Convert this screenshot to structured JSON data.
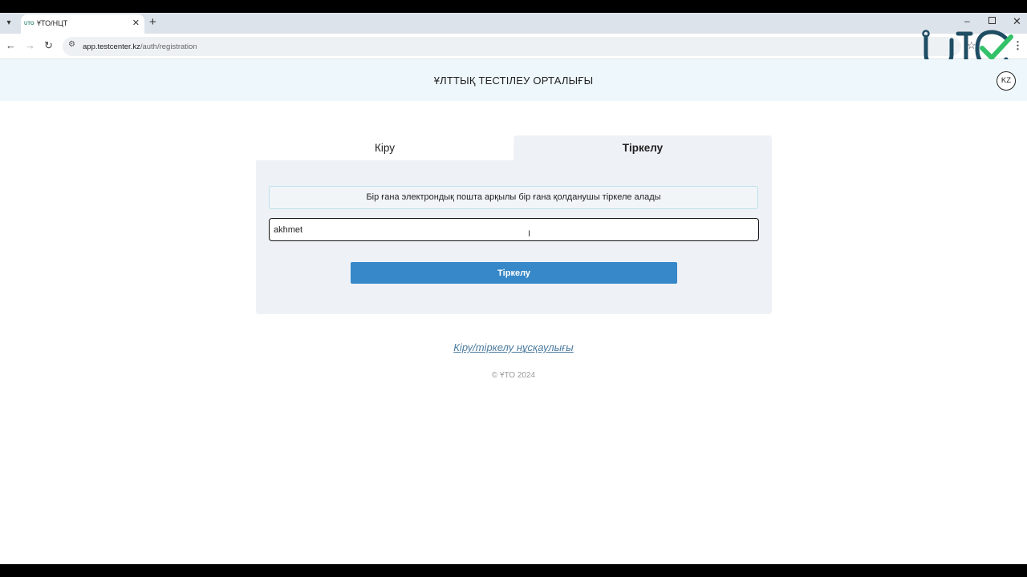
{
  "browser": {
    "tab_title": "ҰТО/НЦТ",
    "tab_favicon": "UTO",
    "url_host": "app.testcenter.kz",
    "url_path": "/auth/registration",
    "icons": {
      "tab_menu": "▾",
      "tab_close": "✕",
      "new_tab": "+",
      "back": "←",
      "forward": "→",
      "reload": "↻",
      "site_info": "⚙",
      "star": "☆",
      "menu": "⋮",
      "minimize": "–",
      "close": "✕"
    }
  },
  "header": {
    "title": "ҰЛТТЫҚ ТЕСТІЛЕУ ОРТАЛЫҒЫ",
    "lang": "KZ"
  },
  "auth": {
    "tab_login": "Кіру",
    "tab_register": "Тіркелу",
    "notice": "Бір ғана электрондық пошта арқылы бір ғана қолданушы тіркеле алады",
    "email_value": "akhmet",
    "cursor": "I",
    "submit_label": "Тіркелу"
  },
  "footer": {
    "guide_link": "Кіру/тіркелу нұсқаулығы",
    "copyright": "© ҰТО 2024"
  },
  "colors": {
    "header_bg": "#eef8fc",
    "card_bg": "#eef2f6",
    "button": "#3788c8",
    "link": "#4a7a9e",
    "logo_teal": "#1f4d63",
    "logo_check": "#33c26a"
  }
}
